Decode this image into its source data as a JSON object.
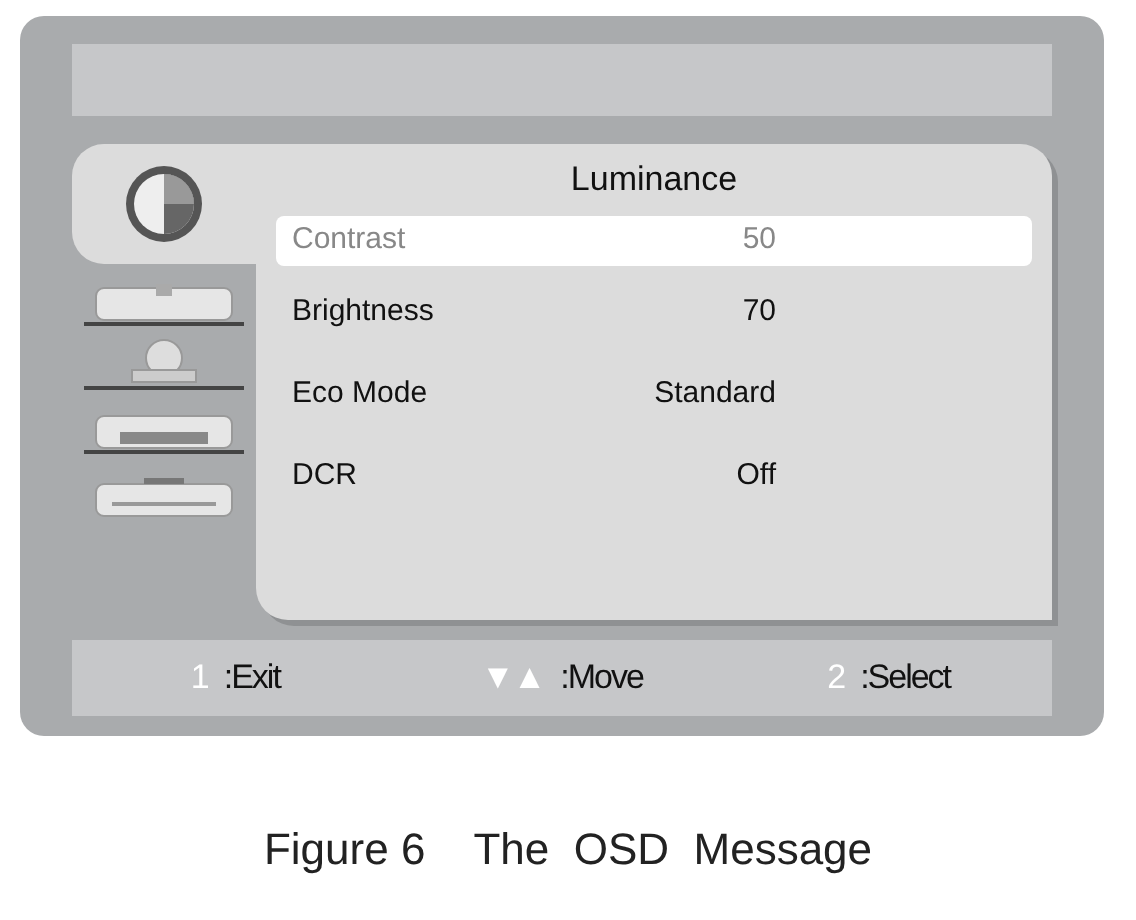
{
  "tabs": [
    {
      "kind": "luminance",
      "selected": true
    },
    {
      "kind": "image",
      "selected": false
    },
    {
      "kind": "color",
      "selected": false
    },
    {
      "kind": "osd",
      "selected": false
    },
    {
      "kind": "setup",
      "selected": false
    }
  ],
  "panel": {
    "title": "Luminance",
    "items": [
      {
        "label": "Contrast",
        "value": "50",
        "selected": true
      },
      {
        "label": "Brightness",
        "value": "70",
        "selected": false
      },
      {
        "label": "Eco Mode",
        "value": "Standard",
        "selected": false
      },
      {
        "label": "DCR",
        "value": "Off",
        "selected": false
      }
    ]
  },
  "footer": [
    {
      "key": "1",
      "action": ":Exit"
    },
    {
      "key": "▼▲",
      "action": ":Move"
    },
    {
      "key": "2",
      "action": ":Select"
    }
  ],
  "caption": "Figure 6    The  OSD  Message"
}
